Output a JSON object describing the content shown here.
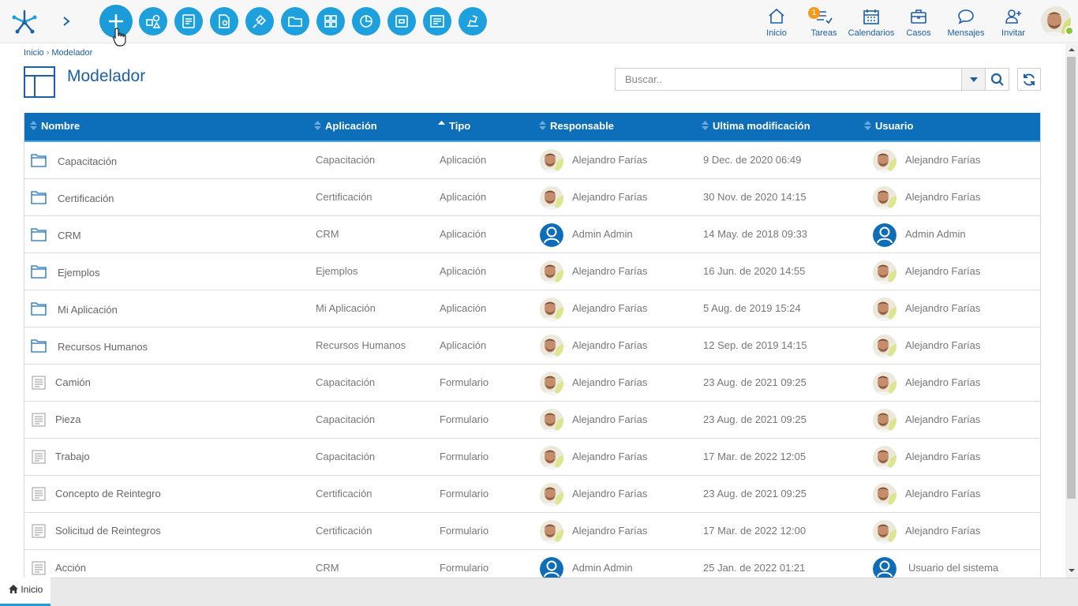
{
  "topbar": {
    "tools": [
      {
        "name": "new-button",
        "icon": "plus-icon"
      },
      {
        "name": "shapes-button",
        "icon": "shapes-icon"
      },
      {
        "name": "form-button",
        "icon": "form-icon"
      },
      {
        "name": "settings-document-button",
        "icon": "document-gear-icon"
      },
      {
        "name": "plugin-button",
        "icon": "plug-icon"
      },
      {
        "name": "folder-button",
        "icon": "folder-icon"
      },
      {
        "name": "grid-button",
        "icon": "grid-icon"
      },
      {
        "name": "chart-button",
        "icon": "pie-chart-icon"
      },
      {
        "name": "archive-button",
        "icon": "archive-icon"
      },
      {
        "name": "report-button",
        "icon": "report-icon"
      },
      {
        "name": "deploy-button",
        "icon": "deploy-icon"
      }
    ],
    "nav": [
      {
        "label": "Inicio"
      },
      {
        "label": "Tareas",
        "badge": "1"
      },
      {
        "label": "Calendarios"
      },
      {
        "label": "Casos"
      },
      {
        "label": "Mensajes"
      },
      {
        "label": "Invitar"
      }
    ]
  },
  "breadcrumb": {
    "home": "Inicio",
    "sep": "›",
    "current": "Modelador"
  },
  "page": {
    "title": "Modelador"
  },
  "search": {
    "placeholder": "Buscar.."
  },
  "table": {
    "headers": {
      "nombre": "Nombre",
      "aplicacion": "Aplicación",
      "tipo": "Tipo",
      "responsable": "Responsable",
      "modificacion": "Ultima modificación",
      "usuario": "Usuario"
    },
    "rows": [
      {
        "nombre": "Capacitación",
        "kind": "folder",
        "aplicacion": "Capacitación",
        "tipo": "Aplicación",
        "responsable": "Alejandro Farías",
        "resp_avatar": "photo",
        "modificacion": "9 Dec. de 2020 06:49",
        "usuario": "Alejandro Farías",
        "user_avatar": "photo"
      },
      {
        "nombre": "Certificación",
        "kind": "folder",
        "aplicacion": "Certificación",
        "tipo": "Aplicación",
        "responsable": "Alejandro Farías",
        "resp_avatar": "photo",
        "modificacion": "30 Nov. de 2020 14:15",
        "usuario": "Alejandro Farías",
        "user_avatar": "photo"
      },
      {
        "nombre": "CRM",
        "kind": "folder",
        "aplicacion": "CRM",
        "tipo": "Aplicación",
        "responsable": "Admin Admin",
        "resp_avatar": "admin",
        "modificacion": "14 May. de 2018 09:33",
        "usuario": "Admin Admin",
        "user_avatar": "admin"
      },
      {
        "nombre": "Ejemplos",
        "kind": "folder",
        "aplicacion": "Ejemplos",
        "tipo": "Aplicación",
        "responsable": "Alejandro Farías",
        "resp_avatar": "photo",
        "modificacion": "16 Jun. de 2020 14:55",
        "usuario": "Alejandro Farías",
        "user_avatar": "photo"
      },
      {
        "nombre": "Mi Aplicación",
        "kind": "folder",
        "aplicacion": "Mi Aplicación",
        "tipo": "Aplicación",
        "responsable": "Alejandro Farías",
        "resp_avatar": "photo",
        "modificacion": "5 Aug. de 2019 15:24",
        "usuario": "Alejandro Farías",
        "user_avatar": "photo"
      },
      {
        "nombre": "Recursos Humanos",
        "kind": "folder",
        "aplicacion": "Recursos Humanos",
        "tipo": "Aplicación",
        "responsable": "Alejandro Farías",
        "resp_avatar": "photo",
        "modificacion": "12 Sep. de 2019 14:15",
        "usuario": "Alejandro Farías",
        "user_avatar": "photo"
      },
      {
        "nombre": "Camión",
        "kind": "form",
        "aplicacion": "Capacitación",
        "tipo": "Formulario",
        "responsable": "Alejandro Farías",
        "resp_avatar": "photo",
        "modificacion": "23 Aug. de 2021 09:25",
        "usuario": "Alejandro Farías",
        "user_avatar": "photo"
      },
      {
        "nombre": "Pieza",
        "kind": "form",
        "aplicacion": "Capacitación",
        "tipo": "Formulario",
        "responsable": "Alejandro Farías",
        "resp_avatar": "photo",
        "modificacion": "23 Aug. de 2021 09:25",
        "usuario": "Alejandro Farías",
        "user_avatar": "photo"
      },
      {
        "nombre": "Trabajo",
        "kind": "form",
        "aplicacion": "Capacitación",
        "tipo": "Formulario",
        "responsable": "Alejandro Farías",
        "resp_avatar": "photo",
        "modificacion": "17 Mar. de 2022 12:05",
        "usuario": "Alejandro Farías",
        "user_avatar": "photo"
      },
      {
        "nombre": "Concepto de Reintegro",
        "kind": "form",
        "aplicacion": "Certificación",
        "tipo": "Formulario",
        "responsable": "Alejandro Farías",
        "resp_avatar": "photo",
        "modificacion": "23 Aug. de 2021 09:25",
        "usuario": "Alejandro Farías",
        "user_avatar": "photo"
      },
      {
        "nombre": "Solicitud de Reintegros",
        "kind": "form",
        "aplicacion": "Certificación",
        "tipo": "Formulario",
        "responsable": "Alejandro Farías",
        "resp_avatar": "photo",
        "modificacion": "17 Mar. de 2022 12:00",
        "usuario": "Alejandro Farías",
        "user_avatar": "photo"
      },
      {
        "nombre": "Acción",
        "kind": "form",
        "aplicacion": "CRM",
        "tipo": "Formulario",
        "responsable": "Admin Admin",
        "resp_avatar": "admin",
        "modificacion": "25 Jan. de 2022 01:21",
        "usuario": "Usuario del sistema",
        "user_avatar": "admin"
      }
    ]
  },
  "bottom": {
    "tab": "Inicio"
  },
  "colors": {
    "accent": "#1ea0dc",
    "header_blue": "#0d6fba",
    "title_blue": "#1d5fa5",
    "badge": "#f39a1c"
  }
}
